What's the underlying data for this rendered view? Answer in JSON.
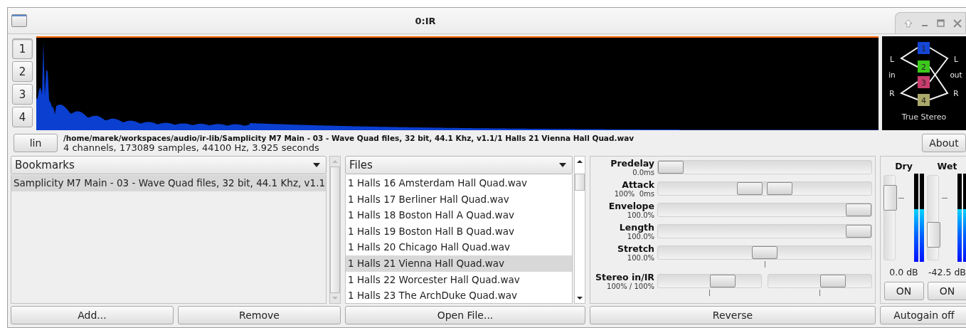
{
  "window": {
    "title": "0:IR"
  },
  "channels": [
    {
      "label": "1",
      "selected": true
    },
    {
      "label": "2",
      "selected": false
    },
    {
      "label": "3",
      "selected": false
    },
    {
      "label": "4",
      "selected": false
    }
  ],
  "scale_button": "lin",
  "file": {
    "path": "/home/marek/workspaces/audio/ir-lib/Samplicity M7 Main - 03 - Wave Quad files, 32 bit, 44.1 Khz, v1.1/1 Halls 21 Vienna Hall Quad.wav",
    "info": "4 channels, 173089 samples, 44100 Hz, 3.925 seconds"
  },
  "routing": {
    "inputs": [
      "L",
      "in",
      "R"
    ],
    "outputs": [
      "L",
      "out",
      "R"
    ],
    "channels": [
      {
        "label": "1",
        "color": "#1446d8"
      },
      {
        "label": "2",
        "color": "#3cc81c"
      },
      {
        "label": "3",
        "color": "#c83c6e"
      },
      {
        "label": "4",
        "color": "#aaa86a"
      }
    ],
    "mode": "True Stereo"
  },
  "about_button": "About",
  "bookmarks": {
    "title": "Bookmarks",
    "items": [
      {
        "label": "Samplicity M7 Main - 03 - Wave Quad files, 32 bit, 44.1 Khz, v1.1",
        "selected": true
      }
    ]
  },
  "files": {
    "title": "Files",
    "items": [
      {
        "label": "1 Halls 16 Amsterdam Hall Quad.wav",
        "selected": false
      },
      {
        "label": "1 Halls 17 Berliner Hall Quad.wav",
        "selected": false
      },
      {
        "label": "1 Halls 18 Boston Hall A Quad.wav",
        "selected": false
      },
      {
        "label": "1 Halls 19 Boston Hall B Quad.wav",
        "selected": false
      },
      {
        "label": "1 Halls 20 Chicago Hall Quad.wav",
        "selected": false
      },
      {
        "label": "1 Halls 21 Vienna Hall Quad.wav",
        "selected": true
      },
      {
        "label": "1 Halls 22 Worcester Hall Quad.wav",
        "selected": false
      },
      {
        "label": "1 Halls 23 The ArchDuke Quad.wav",
        "selected": false
      }
    ]
  },
  "controls": [
    {
      "kind": "single",
      "name": "Predelay",
      "reading": "0.0ms",
      "handles": [
        {
          "level": 0
        }
      ]
    },
    {
      "kind": "range",
      "name": "Attack",
      "reading": "100%  0ms",
      "handles": [
        {
          "level": 0.42
        },
        {
          "level": 0.58
        }
      ]
    },
    {
      "kind": "single",
      "name": "Envelope",
      "reading": "100.0%",
      "handles": [
        {
          "level": 1
        }
      ]
    },
    {
      "kind": "single",
      "name": "Length",
      "reading": "100.0%",
      "handles": [
        {
          "level": 1
        }
      ]
    },
    {
      "kind": "centered",
      "name": "Stretch",
      "reading": "100.0%",
      "handles": [
        {
          "level": 0.5
        }
      ]
    },
    {
      "kind": "split",
      "name": "Stereo in/IR",
      "reading": "100% / 100%",
      "handles": [
        {
          "level": 0.67
        },
        {
          "level": 0.67
        }
      ]
    }
  ],
  "mix": [
    {
      "label": "Dry",
      "level": 0.84,
      "reading": "0.0 dB",
      "toggle": "ON"
    },
    {
      "label": "Wet",
      "level": 0.23,
      "reading": "-42.5 dB",
      "toggle": "ON"
    }
  ],
  "buttons": {
    "add": "Add...",
    "remove": "Remove",
    "open": "Open File...",
    "reverse": "Reverse",
    "autogain": "Autogain off"
  }
}
